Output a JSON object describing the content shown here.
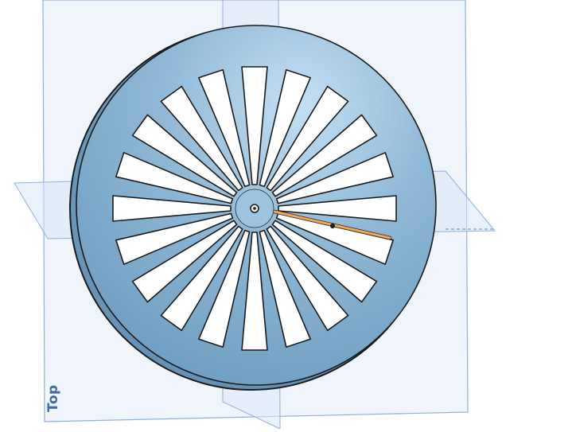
{
  "viewport": {
    "view_label": "Top",
    "colors": {
      "plane_fill": "#eaf1fb",
      "plane_edge": "#8fb0dc",
      "part_fill": "#7ea9c9",
      "part_highlight": "#b9d7ef",
      "part_edge": "#1b1b1b",
      "selection": "#f0a65a"
    },
    "part": {
      "spoke_count": 20,
      "features": [
        "outer-rim",
        "face",
        "spoke-slots",
        "center-hub",
        "center-hole",
        "selected-edge",
        "sketch-point"
      ]
    }
  }
}
